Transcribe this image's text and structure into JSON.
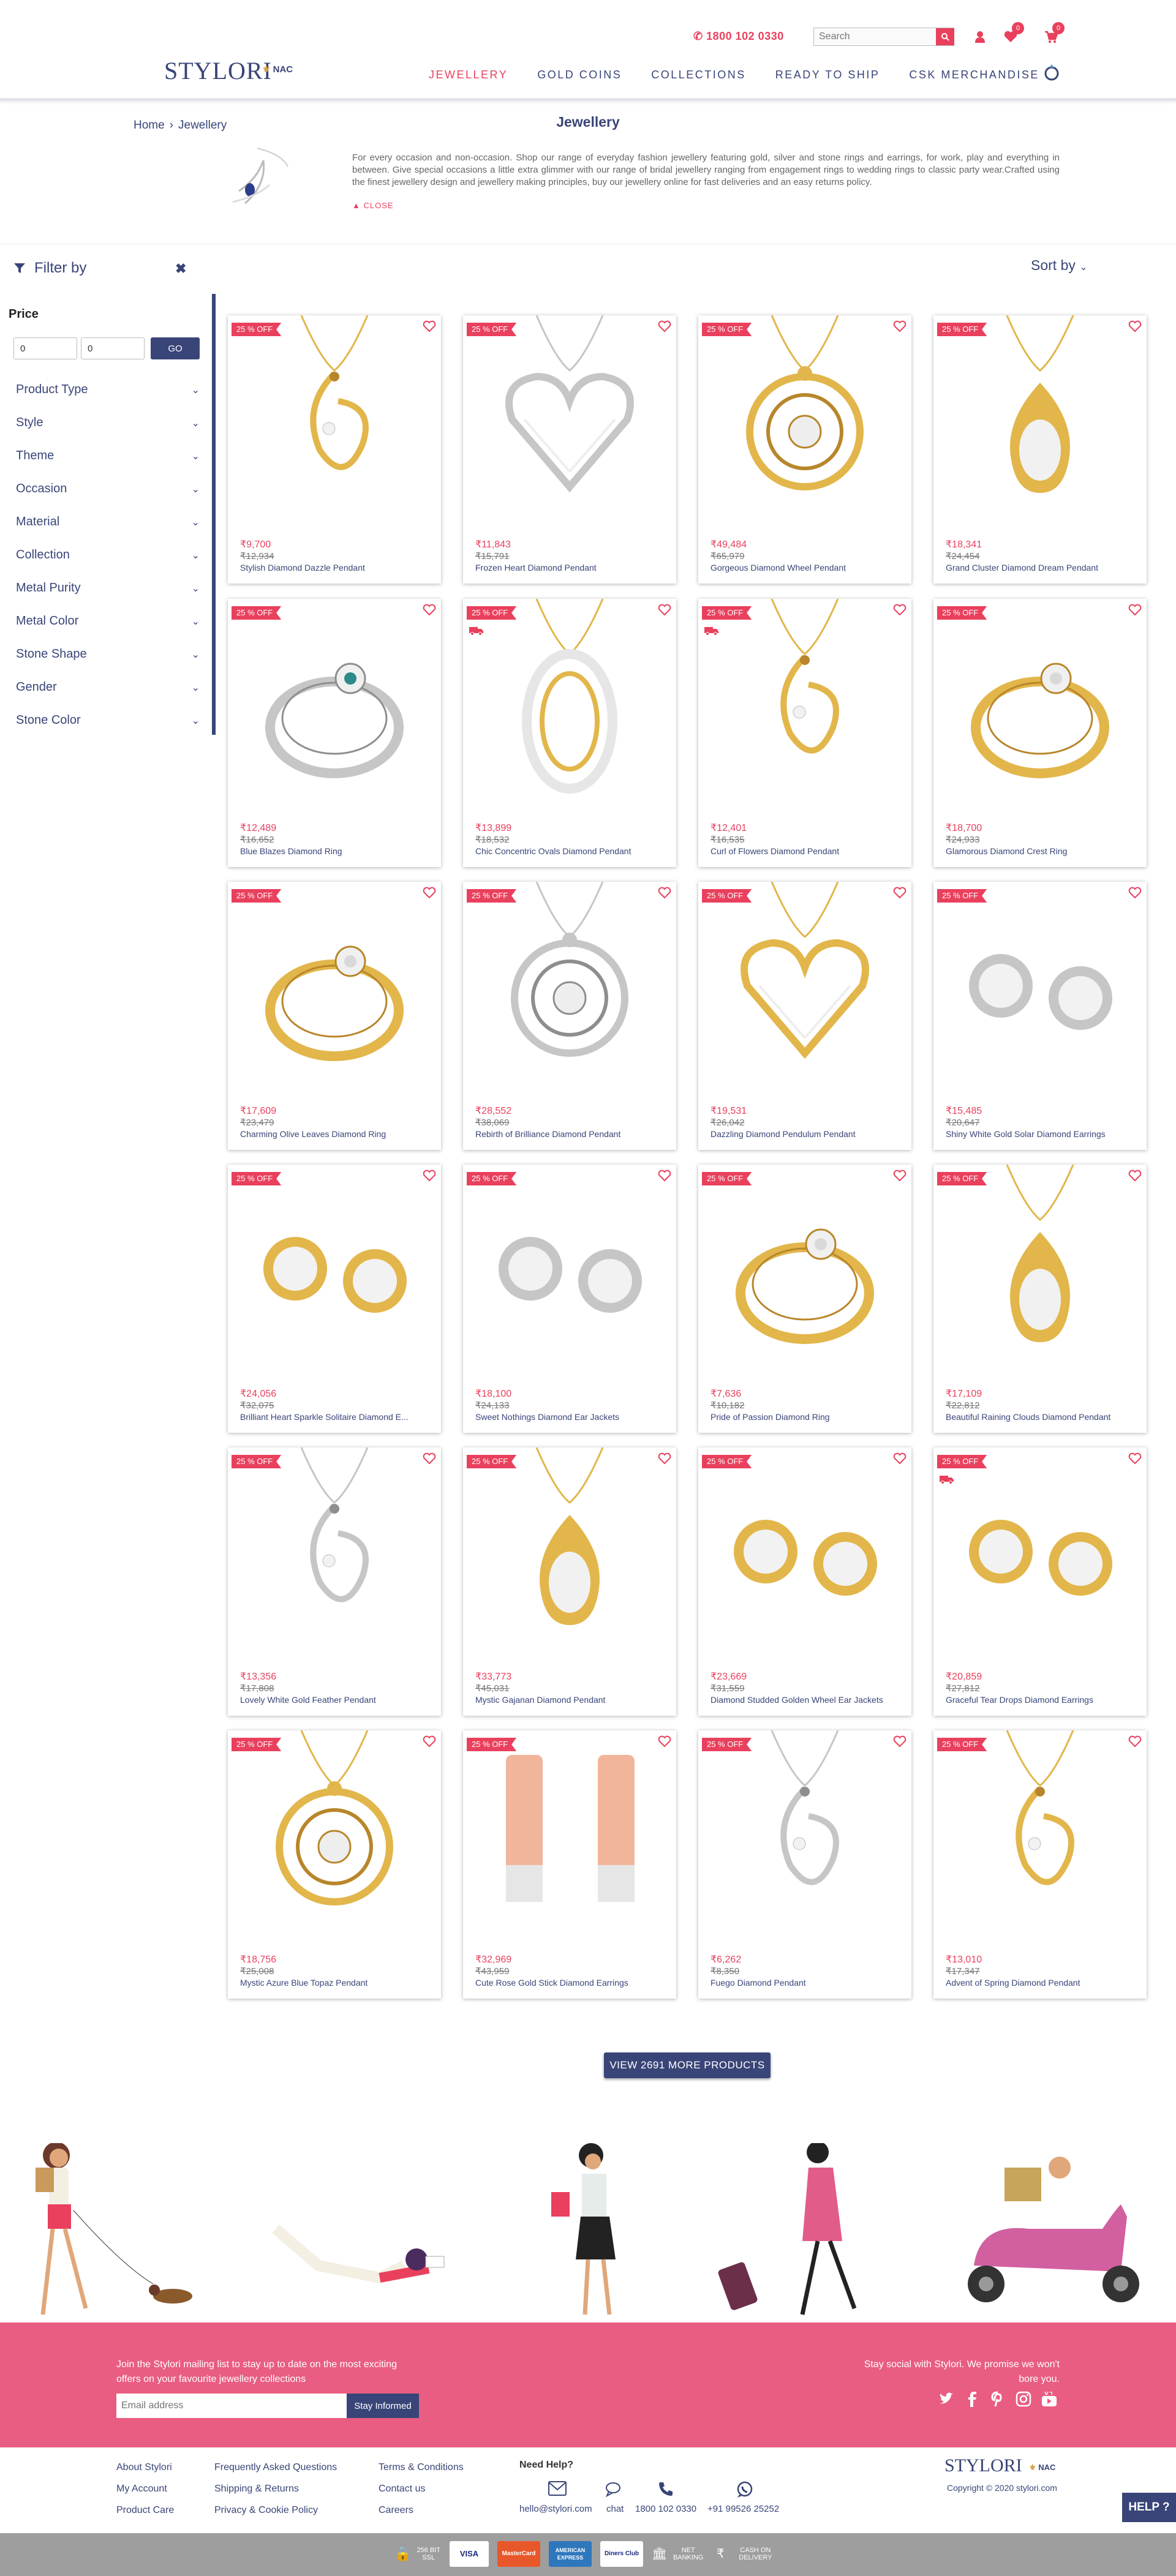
{
  "header": {
    "phone": "1800 102 0330",
    "search_placeholder": "Search",
    "wishlist_count": "0",
    "cart_count": "0",
    "logo": "STYLORI",
    "logo_partner": "NAC",
    "nav": [
      "JEWELLERY",
      "GOLD COINS",
      "COLLECTIONS",
      "READY TO SHIP",
      "CSK MERCHANDISE"
    ]
  },
  "breadcrumb": {
    "home": "Home",
    "current": "Jewellery"
  },
  "category": {
    "title": "Jewellery",
    "description": "For every occasion and non-occasion. Shop our range of everyday fashion jewellery featuring gold, silver and stone rings and earrings, for work, play and everything in between. Give special occasions a little extra glimmer with our range of bridal jewellery ranging from engagement rings to wedding rings to classic party wear.Crafted using the finest jewellery design and jewellery making principles, buy our jewellery online for fast deliveries and an easy returns policy.",
    "close_label": "CLOSE"
  },
  "filters": {
    "title": "Filter by",
    "sort_label": "Sort by",
    "price_label": "Price",
    "price_min": "0",
    "price_max": "0",
    "go_label": "GO",
    "items": [
      "Product Type",
      "Style",
      "Theme",
      "Occasion",
      "Material",
      "Collection",
      "Metal Purity",
      "Metal Color",
      "Stone Shape",
      "Gender",
      "Stone Color"
    ]
  },
  "products": [
    {
      "offer": "25 % OFF",
      "price": "₹9,700",
      "mrp": "₹12,934",
      "name": "Stylish Diamond Dazzle Pendant",
      "kind": "pendant",
      "metal": "gold",
      "truck": false
    },
    {
      "offer": "25 % OFF",
      "price": "₹11,843",
      "mrp": "₹15,791",
      "name": "Frozen Heart Diamond Pendant",
      "kind": "heart",
      "metal": "white",
      "truck": false
    },
    {
      "offer": "25 % OFF",
      "price": "₹49,484",
      "mrp": "₹65,979",
      "name": "Gorgeous Diamond Wheel Pendant",
      "kind": "wheel",
      "metal": "gold",
      "truck": false
    },
    {
      "offer": "25 % OFF",
      "price": "₹18,341",
      "mrp": "₹24,454",
      "name": "Grand Cluster Diamond Dream Pendant",
      "kind": "drop",
      "metal": "gold",
      "truck": false
    },
    {
      "offer": "25 % OFF",
      "price": "₹12,489",
      "mrp": "₹16,652",
      "name": "Blue Blazes Diamond Ring",
      "kind": "ring",
      "metal": "white",
      "truck": false
    },
    {
      "offer": "25 % OFF",
      "price": "₹13,899",
      "mrp": "₹18,532",
      "name": "Chic Concentric Ovals Diamond Pendant",
      "kind": "oval",
      "metal": "gold",
      "truck": true
    },
    {
      "offer": "25 % OFF",
      "price": "₹12,401",
      "mrp": "₹16,535",
      "name": "Curl of Flowers Diamond Pendant",
      "kind": "pendant",
      "metal": "gold",
      "truck": true
    },
    {
      "offer": "25 % OFF",
      "price": "₹18,700",
      "mrp": "₹24,933",
      "name": "Glamorous Diamond Crest Ring",
      "kind": "ring",
      "metal": "gold",
      "truck": false
    },
    {
      "offer": "25 % OFF",
      "price": "₹17,609",
      "mrp": "₹23,479",
      "name": "Charming Olive Leaves Diamond Ring",
      "kind": "ring",
      "metal": "gold",
      "truck": false
    },
    {
      "offer": "25 % OFF",
      "price": "₹28,552",
      "mrp": "₹38,069",
      "name": "Rebirth of Brilliance Diamond Pendant",
      "kind": "wheel",
      "metal": "white",
      "truck": false
    },
    {
      "offer": "25 % OFF",
      "price": "₹19,531",
      "mrp": "₹26,042",
      "name": "Dazzling Diamond Pendulum Pendant",
      "kind": "heart",
      "metal": "gold",
      "truck": false
    },
    {
      "offer": "25 % OFF",
      "price": "₹15,485",
      "mrp": "₹20,647",
      "name": "Shiny White Gold Solar Diamond Earrings",
      "kind": "earrings",
      "metal": "white",
      "truck": false
    },
    {
      "offer": "25 % OFF",
      "price": "₹24,056",
      "mrp": "₹32,075",
      "name": "Brilliant Heart Sparkle Solitaire Diamond E...",
      "kind": "earrings",
      "metal": "gold",
      "truck": false
    },
    {
      "offer": "25 % OFF",
      "price": "₹18,100",
      "mrp": "₹24,133",
      "name": "Sweet Nothings Diamond Ear Jackets",
      "kind": "earrings",
      "metal": "white",
      "truck": false
    },
    {
      "offer": "25 % OFF",
      "price": "₹7,636",
      "mrp": "₹10,182",
      "name": "Pride of Passion Diamond Ring",
      "kind": "ring",
      "metal": "gold",
      "truck": false
    },
    {
      "offer": "25 % OFF",
      "price": "₹17,109",
      "mrp": "₹22,812",
      "name": "Beautiful Raining Clouds Diamond Pendant",
      "kind": "drop",
      "metal": "gold",
      "truck": false
    },
    {
      "offer": "25 % OFF",
      "price": "₹13,356",
      "mrp": "₹17,808",
      "name": "Lovely White Gold Feather Pendant",
      "kind": "pendant",
      "metal": "white",
      "truck": false
    },
    {
      "offer": "25 % OFF",
      "price": "₹33,773",
      "mrp": "₹45,031",
      "name": "Mystic Gajanan Diamond Pendant",
      "kind": "drop",
      "metal": "gold",
      "truck": false
    },
    {
      "offer": "25 % OFF",
      "price": "₹23,669",
      "mrp": "₹31,559",
      "name": "Diamond Studded Golden Wheel Ear Jackets",
      "kind": "earrings",
      "metal": "gold",
      "truck": false
    },
    {
      "offer": "25 % OFF",
      "price": "₹20,859",
      "mrp": "₹27,812",
      "name": "Graceful Tear Drops Diamond Earrings",
      "kind": "earrings",
      "metal": "gold",
      "truck": true
    },
    {
      "offer": "25 % OFF",
      "price": "₹18,756",
      "mrp": "₹25,008",
      "name": "Mystic Azure Blue Topaz Pendant",
      "kind": "wheel",
      "metal": "gold",
      "truck": false
    },
    {
      "offer": "25 % OFF",
      "price": "₹32,969",
      "mrp": "₹43,959",
      "name": "Cute Rose Gold Stick Diamond Earrings",
      "kind": "sticks",
      "metal": "rose",
      "truck": false
    },
    {
      "offer": "25 % OFF",
      "price": "₹6,262",
      "mrp": "₹8,350",
      "name": "Fuego Diamond Pendant",
      "kind": "pendant",
      "metal": "white",
      "truck": false
    },
    {
      "offer": "25 % OFF",
      "price": "₹13,010",
      "mrp": "₹17,347",
      "name": "Advent of Spring Diamond Pendant",
      "kind": "pendant",
      "metal": "gold",
      "truck": false
    }
  ],
  "more_button": "VIEW 2691 MORE PRODUCTS",
  "newsletter": {
    "text": "Join the Stylori mailing list to stay up to date on the most exciting offers on your favourite jewellery collections",
    "email_placeholder": "Email address",
    "button": "Stay Informed",
    "social_text": "Stay social with Stylori. We promise we won't bore you."
  },
  "footer": {
    "col1": [
      "About Stylori",
      "My Account",
      "Product Care"
    ],
    "col2": [
      "Frequently Asked Questions",
      "Shipping & Returns",
      "Privacy & Cookie Policy"
    ],
    "col3": [
      "Terms & Conditions",
      "Contact us",
      "Careers"
    ],
    "need_help": "Need Help?",
    "contacts": [
      "hello@stylori.com",
      "chat",
      "1800 102 0330",
      "+91 99526 25252"
    ],
    "logo": "STYLORI",
    "logo_partner": "NAC",
    "copyright": "Copyright © 2020 stylori.com",
    "help_button": "HELP ?"
  },
  "payments": [
    "256 BIT SSL",
    "VISA",
    "MasterCard",
    "AMERICAN EXPRESS",
    "Diners Club",
    "NET BANKING",
    "CASH ON DELIVERY"
  ],
  "colors": {
    "brand_navy": "#394578",
    "brand_pink": "#e9405d",
    "newsletter_pink": "#e95d82"
  }
}
